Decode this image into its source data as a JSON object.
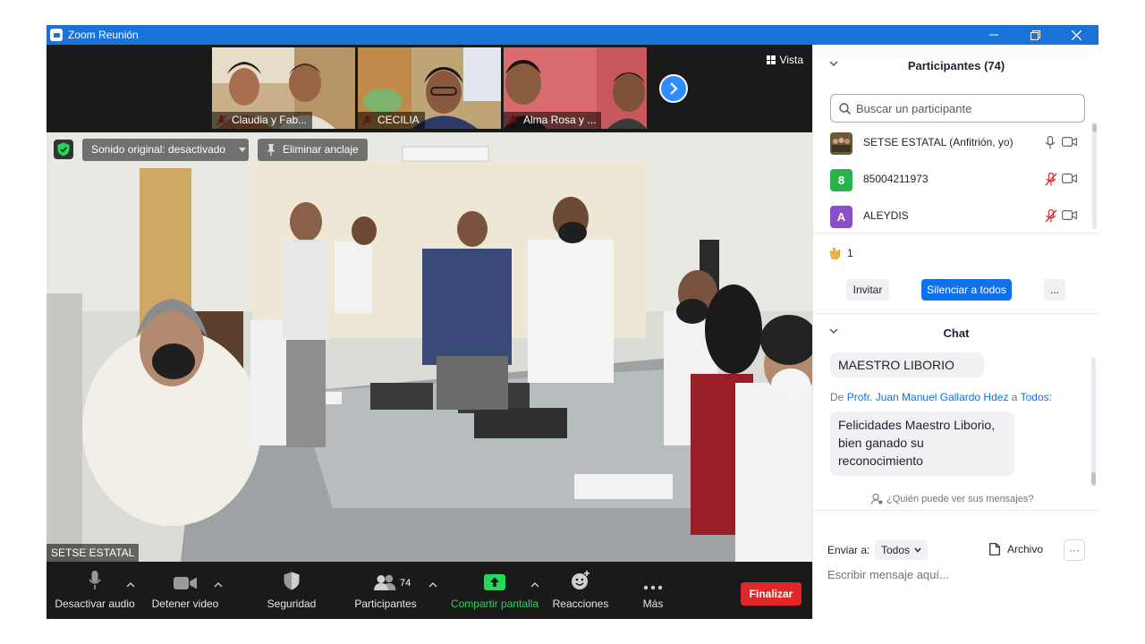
{
  "window": {
    "title": "Zoom Reunión"
  },
  "video": {
    "view_label": "Vista",
    "thumbnails": [
      {
        "name": "Claudia y Fab..."
      },
      {
        "name": "CECILIA"
      },
      {
        "name": "Alma Rosa y ..."
      }
    ],
    "sound_label": "Sonido original: desactivado",
    "unpin_label": "Eliminar anclaje",
    "main_name": "SETSE ESTATAL"
  },
  "toolbar": {
    "mute": "Desactivar audio",
    "video": "Detener video",
    "security": "Seguridad",
    "participants": "Participantes",
    "participants_count": "74",
    "share": "Compartir pantalla",
    "reactions": "Reacciones",
    "more": "Más",
    "end": "Finalizar"
  },
  "participants_panel": {
    "title": "Participantes (74)",
    "search_placeholder": "Buscar un participante",
    "items": [
      {
        "name": "SETSE ESTATAL (Anfitrión, yo)",
        "avatar": "",
        "avatar_color": "#6b5a3a",
        "mic": "on"
      },
      {
        "name": "85004211973",
        "avatar": "8",
        "avatar_color": "#28b24b",
        "mic": "muted"
      },
      {
        "name": "ALEYDIS",
        "avatar": "A",
        "avatar_color": "#8a4fc7",
        "mic": "muted"
      }
    ],
    "reaction_count": "1",
    "invite": "Invitar",
    "mute_all": "Silenciar a todos",
    "more": "..."
  },
  "chat_panel": {
    "title": "Chat",
    "messages": [
      {
        "text": "MAESTRO LIBORIO"
      },
      {
        "from_prefix": "De",
        "from": "Profr. Juan Manuel Gallardo Hdez",
        "to_prefix": "a",
        "to": "Todos:",
        "text": "Felicidades Maestro Liborio, bien ganado su reconocimiento"
      }
    ],
    "who_can_see": "¿Quién puede ver sus mensajes?",
    "send_to_label": "Enviar a:",
    "send_to_value": "Todos",
    "file_label": "Archivo",
    "more": "···",
    "input_placeholder": "Escribir mensaje aquí..."
  },
  "colors": {
    "accent": "#0e72ed",
    "titlebar": "#1a73d9",
    "end": "#e02828",
    "share": "#23d959"
  }
}
